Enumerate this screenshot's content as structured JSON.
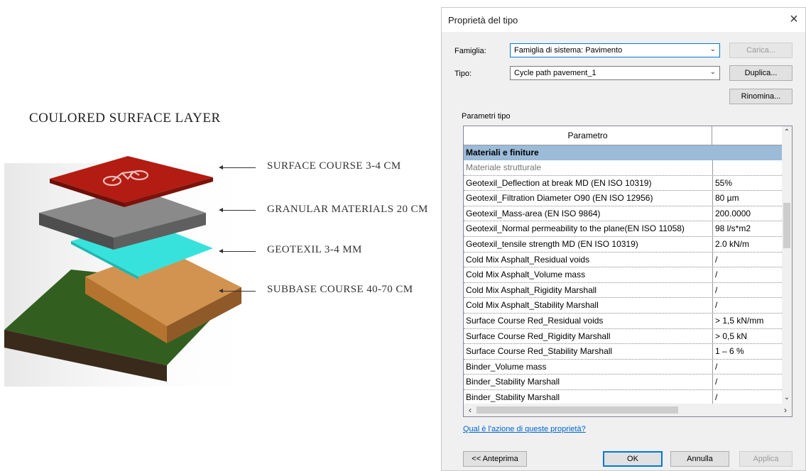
{
  "illustration": {
    "title": "COULORED SURFACE LAYER",
    "layers": [
      {
        "label": "SURFACE COURSE 3-4 CM",
        "color": "#b31c12"
      },
      {
        "label": "GRANULAR MATERIALS 20 CM",
        "color": "#6f6f6f"
      },
      {
        "label": "GEOTEXIL  3-4 MM",
        "color": "#35e1da"
      },
      {
        "label": "SUBBASE COURSE 40-70 CM",
        "color": "#c7863f"
      }
    ]
  },
  "dialog": {
    "title": "Proprietà del tipo",
    "close_glyph": "×",
    "family_label": "Famiglia:",
    "family_value": "Famiglia di sistema: Pavimento",
    "type_label": "Tipo:",
    "type_value": "Cycle path pavement_1",
    "load_button": "Carica...",
    "duplicate_button": "Duplica...",
    "rename_button": "Rinomina...",
    "section_label": "Parametri tipo",
    "grid": {
      "column_header": "Parametro",
      "value_header": "",
      "group": "Materiali e finiture",
      "rows": [
        {
          "name": "Materiale strutturale",
          "value": ""
        },
        {
          "name": "Geotexil_Deflection at break MD (EN ISO 10319)",
          "value": "55%"
        },
        {
          "name": "Geotexil_Filtration Diameter O90 (EN ISO 12956)",
          "value": "80 µm"
        },
        {
          "name": "Geotexil_Mass-area (EN ISO 9864)",
          "value": "200.0000"
        },
        {
          "name": "Geotexil_Normal permeability to the plane(EN ISO 11058)",
          "value": "98 l/s*m2"
        },
        {
          "name": "Geotexil_tensile strength MD (EN ISO 10319)",
          "value": "2.0 kN/m"
        },
        {
          "name": "Cold Mix Asphalt_Residual voids",
          "value": "/"
        },
        {
          "name": "Cold Mix Asphalt_Volume mass",
          "value": "/"
        },
        {
          "name": "Cold Mix Asphalt_Rigidity Marshall",
          "value": "/"
        },
        {
          "name": "Cold Mix Asphalt_Stability Marshall",
          "value": "/"
        },
        {
          "name": "Surface Course Red_Residual voids",
          "value": "> 1,5 kN/mm"
        },
        {
          "name": "Surface Course Red_Rigidity Marshall",
          "value": "> 0,5 kN"
        },
        {
          "name": "Surface Course Red_Stability Marshall",
          "value": "1 – 6 %"
        },
        {
          "name": "Binder_Volume mass",
          "value": "/"
        },
        {
          "name": "Binder_Stability Marshall",
          "value": "/"
        },
        {
          "name": "Binder_Stability Marshall",
          "value": "/"
        }
      ]
    },
    "help_link": "Qual è l'azione di queste proprietà?",
    "preview_button": "<< Anteprima",
    "ok_button": "OK",
    "cancel_button": "Annulla",
    "apply_button": "Applica"
  }
}
